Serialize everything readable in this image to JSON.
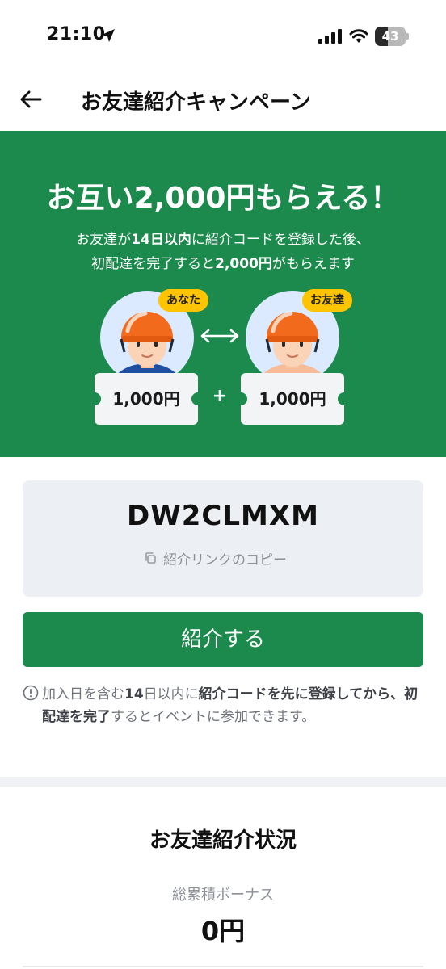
{
  "status_bar": {
    "time": "21:10",
    "battery_level": "43",
    "icons": [
      "location-arrow-icon",
      "signal-icon",
      "wifi-icon",
      "battery-icon"
    ]
  },
  "header": {
    "back_icon": "arrow-left-icon",
    "title": "お友達紹介キャンペーン"
  },
  "hero": {
    "title": "お互い2,000円もらえる！",
    "desc": {
      "p1": "お友達が",
      "b1": "14日以内",
      "p2": "に紹介コードを登録した後、",
      "p3": "初配達を完了すると",
      "b2": "2,000円",
      "p4": "がもらえます"
    },
    "you_badge": "あなた",
    "friend_badge": "お友達",
    "you_amount": "1,000円",
    "friend_amount": "1,000円",
    "plus": "+",
    "colors": {
      "background": "#1b8a4c",
      "badge": "#ffc400",
      "helmet": "#f26b1d"
    }
  },
  "referral": {
    "code": "DW2CLMXM",
    "copy_label": "紹介リンクのコピー"
  },
  "cta": {
    "label": "紹介する"
  },
  "note": {
    "p1": "加入日を含む",
    "b1": "14",
    "p2": "日以内に",
    "b2": "紹介コードを先に登録してから、初配達を完了",
    "p3": "するとイベントに参加できます。"
  },
  "status_section": {
    "title": "お友達紹介状況",
    "bonus_label": "総累積ボーナス",
    "bonus_value": "0円"
  }
}
